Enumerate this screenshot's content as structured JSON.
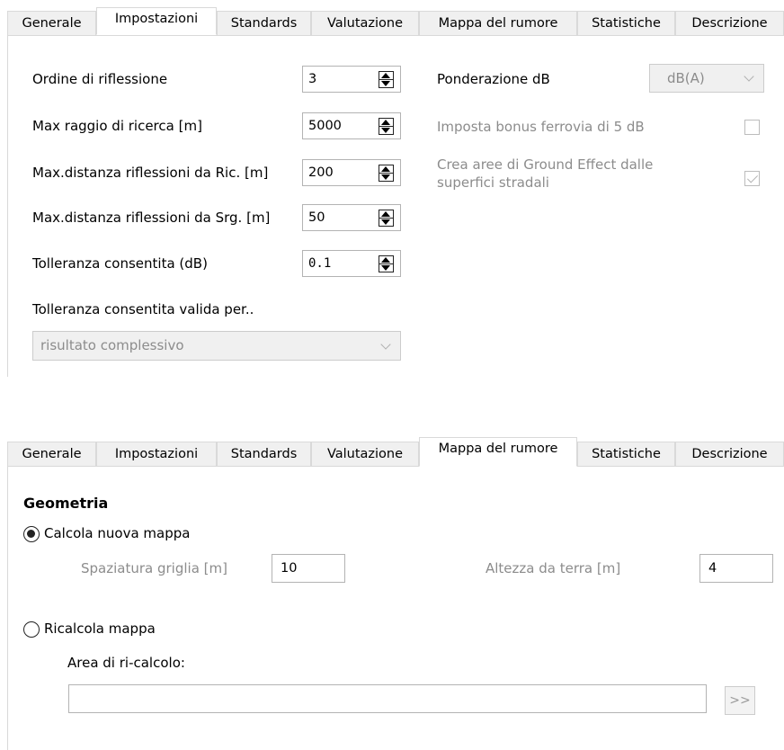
{
  "tabs": [
    "Generale",
    "Impostazioni",
    "Standards",
    "Valutazione",
    "Mappa del rumore",
    "Statistiche",
    "Descrizione"
  ],
  "panel1": {
    "active_tab": "Impostazioni",
    "fields": [
      {
        "label": "Ordine di riflessione",
        "value": "3"
      },
      {
        "label": "Max raggio di ricerca [m]",
        "value": "5000"
      },
      {
        "label": "Max.distanza riflessioni da Ric. [m]",
        "value": "200"
      },
      {
        "label": "Max.distanza riflessioni da Srg. [m]",
        "value": "50"
      },
      {
        "label": "Tolleranza consentita (dB)",
        "value": "0.1"
      }
    ],
    "tolerance_scope_label": "Tolleranza consentita valida per..",
    "tolerance_scope_value": "risultato complessivo",
    "weighting_label": "Ponderazione dB",
    "weighting_value": "dB(A)",
    "rail_bonus_label": "Imposta bonus ferrovia di 5 dB",
    "rail_bonus_checked": false,
    "ground_effect_label_line1": "Crea aree di Ground Effect dalle",
    "ground_effect_label_line2": "superfici stradali",
    "ground_effect_checked": true
  },
  "panel2": {
    "active_tab": "Mappa del rumore",
    "section_title": "Geometria",
    "calc_new_label": "Calcola nuova mappa",
    "calc_new_selected": true,
    "grid_spacing_label": "Spaziatura griglia [m]",
    "grid_spacing_value": "10",
    "height_label": "Altezza da terra [m]",
    "height_value": "4",
    "recalc_label": "Ricalcola mappa",
    "recalc_selected": false,
    "recalc_area_label": "Area di ri-calcolo:",
    "recalc_area_value": "",
    "browse_button": ">>"
  }
}
